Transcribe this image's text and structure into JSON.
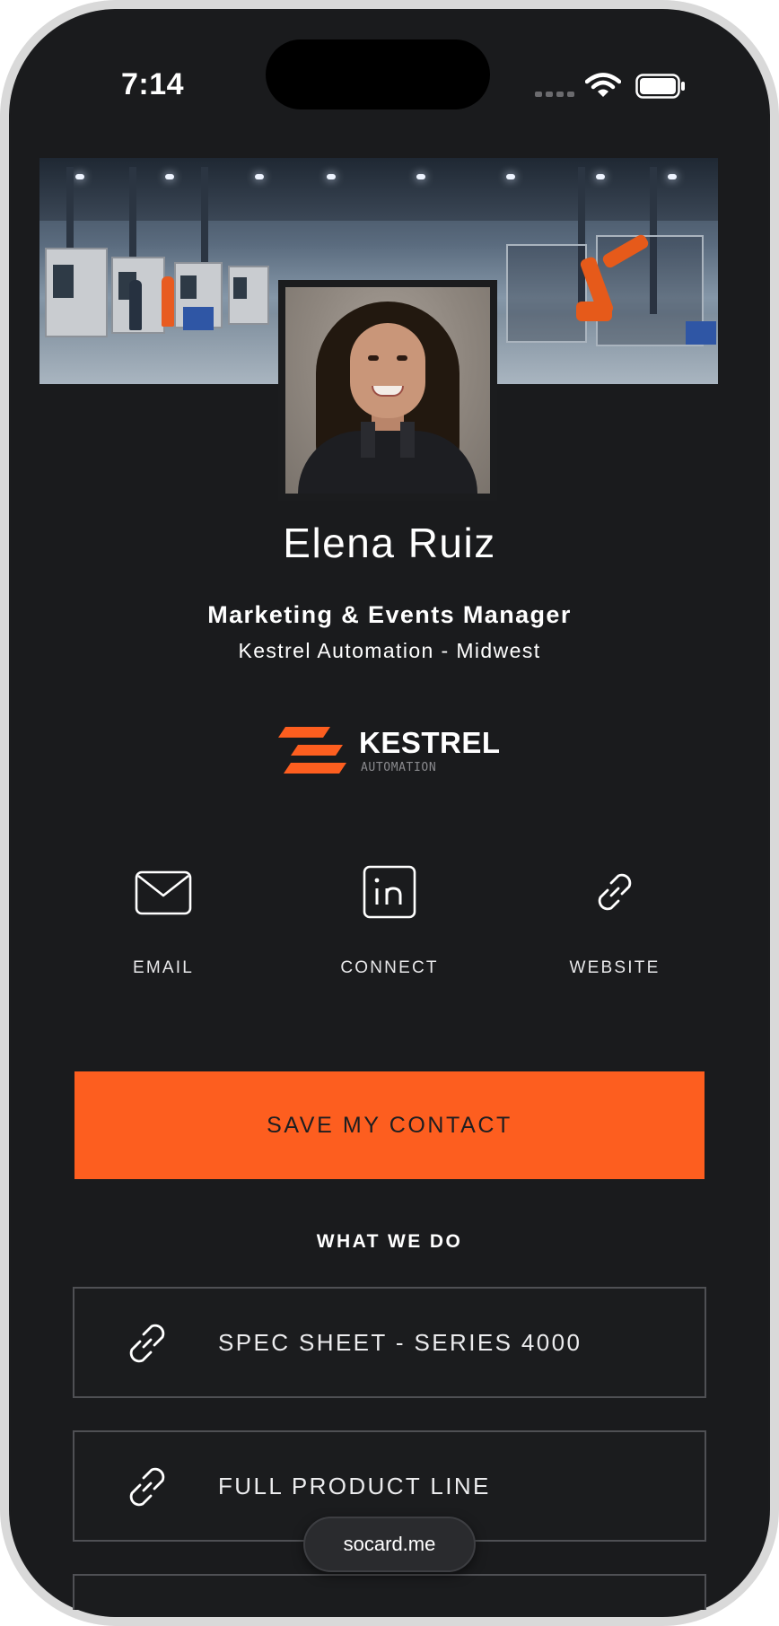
{
  "status_bar": {
    "time": "7:14",
    "wifi_icon": "wifi-icon",
    "battery_icon": "battery-full-icon"
  },
  "profile": {
    "name": "Elena Ruiz",
    "title": "Marketing & Events Manager",
    "company": "Kestrel Automation - Midwest"
  },
  "logo": {
    "wordmark": "KESTREL",
    "subtitle": "AUTOMATION"
  },
  "actions": [
    {
      "label": "EMAIL",
      "icon": "envelope-icon"
    },
    {
      "label": "CONNECT",
      "icon": "linkedin-icon"
    },
    {
      "label": "WEBSITE",
      "icon": "link-icon"
    }
  ],
  "cta": {
    "label": "SAVE MY CONTACT"
  },
  "what_we_do": {
    "heading": "WHAT WE DO",
    "links": [
      {
        "label": "SPEC SHEET - SERIES 4000",
        "icon": "link-icon"
      },
      {
        "label": "FULL PRODUCT LINE",
        "icon": "link-icon"
      }
    ]
  },
  "footer": {
    "badge": "socard.me"
  },
  "colors": {
    "background": "#1a1b1d",
    "accent": "#fd5e1f",
    "text": "#ffffff",
    "border": "#4f5054"
  }
}
